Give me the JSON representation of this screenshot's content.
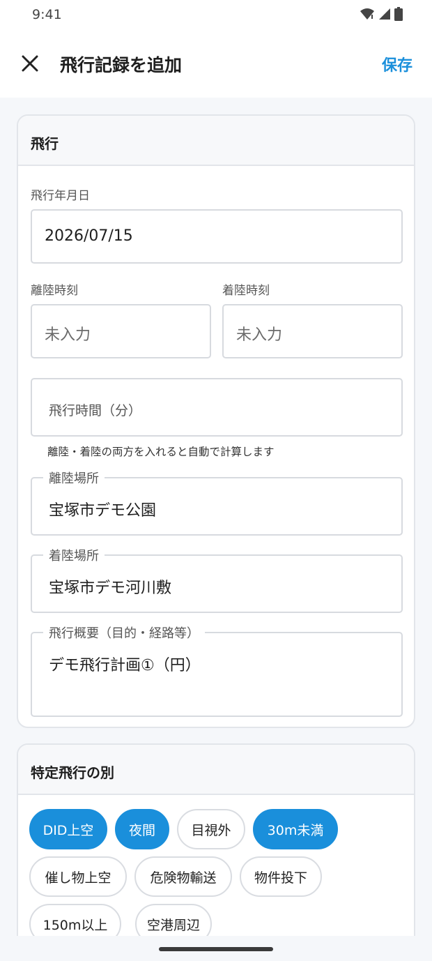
{
  "status_bar": {
    "time": "9:41"
  },
  "app_bar": {
    "title": "飛行記録を追加",
    "save_label": "保存",
    "close_icon": "close-icon"
  },
  "flight_section": {
    "header": "飛行",
    "date_label": "飛行年月日",
    "date_value": "2026/07/15",
    "takeoff_time_label": "離陸時刻",
    "takeoff_time_placeholder": "未入力",
    "landing_time_label": "着陸時刻",
    "landing_time_placeholder": "未入力",
    "duration_placeholder": "飛行時間（分）",
    "duration_helper": "離陸・着陸の両方を入れると自動で計算します",
    "takeoff_place_label": "離陸場所",
    "takeoff_place_value": "宝塚市デモ公園",
    "landing_place_label": "着陸場所",
    "landing_place_value": "宝塚市デモ河川敷",
    "summary_label": "飛行概要（目的・経路等）",
    "summary_value": "デモ飛行計画①（円）"
  },
  "specific_flight_section": {
    "header": "特定飛行の別",
    "chips": [
      {
        "label": "DID上空",
        "selected": true
      },
      {
        "label": "夜間",
        "selected": true
      },
      {
        "label": "目視外",
        "selected": false
      },
      {
        "label": "30m未満",
        "selected": true
      },
      {
        "label": "催し物上空",
        "selected": false
      },
      {
        "label": "危険物輸送",
        "selected": false
      },
      {
        "label": "物件投下",
        "selected": false
      },
      {
        "label": "150m以上",
        "selected": false
      },
      {
        "label": "空港周辺",
        "selected": false
      }
    ]
  },
  "colors": {
    "accent": "#1a8fdb",
    "background": "#f5f7fa",
    "card_border": "#e2e5ea"
  }
}
